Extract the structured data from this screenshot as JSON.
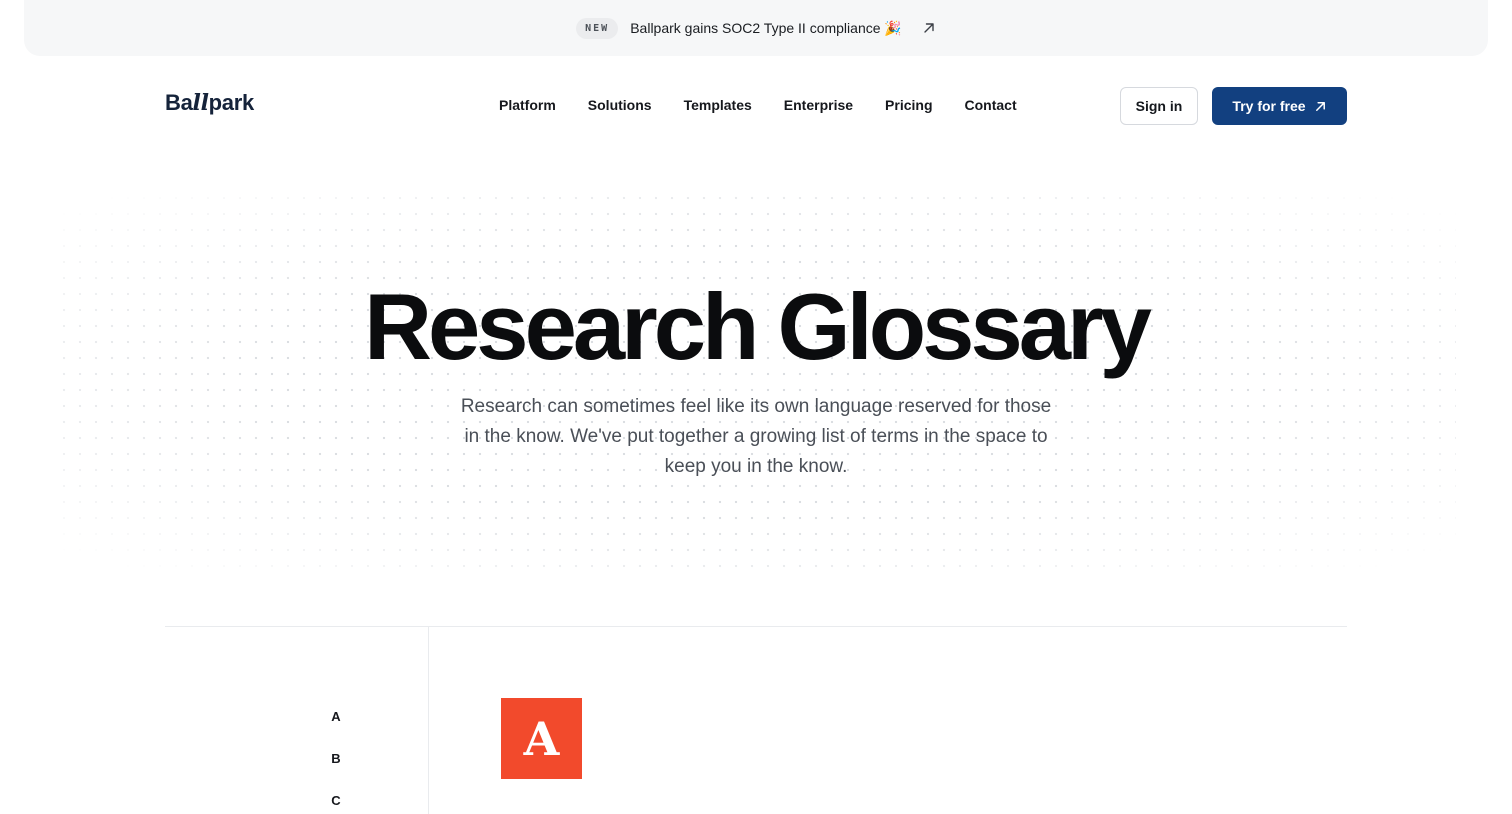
{
  "announcement": {
    "badge": "NEW",
    "text": "Ballpark gains SOC2 Type II compliance 🎉",
    "icon": "arrow-up-right-icon"
  },
  "header": {
    "logo_text_a": "Ba",
    "logo_text_b": "ll",
    "logo_text_c": "park",
    "nav": [
      "Platform",
      "Solutions",
      "Templates",
      "Enterprise",
      "Pricing",
      "Contact"
    ],
    "sign_in": "Sign in",
    "try_free": "Try for free"
  },
  "hero": {
    "title": "Research Glossary",
    "subtitle": "Research can sometimes feel like its own language reserved for those in the know. We've put together a growing list of terms in the space to keep you in the know."
  },
  "glossary": {
    "letters": [
      "A",
      "B",
      "C"
    ],
    "current_letter": "A"
  },
  "colors": {
    "primary": "#124080",
    "accent": "#f24a2c"
  }
}
